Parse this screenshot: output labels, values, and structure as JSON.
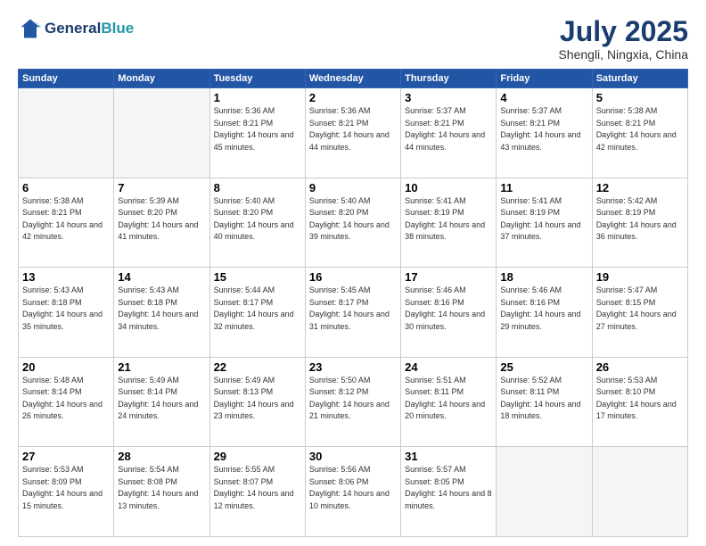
{
  "header": {
    "logo_line1": "General",
    "logo_line2": "Blue",
    "month": "July 2025",
    "location": "Shengli, Ningxia, China"
  },
  "weekdays": [
    "Sunday",
    "Monday",
    "Tuesday",
    "Wednesday",
    "Thursday",
    "Friday",
    "Saturday"
  ],
  "weeks": [
    [
      {
        "day": "",
        "sunrise": "",
        "sunset": "",
        "daylight": ""
      },
      {
        "day": "",
        "sunrise": "",
        "sunset": "",
        "daylight": ""
      },
      {
        "day": "1",
        "sunrise": "Sunrise: 5:36 AM",
        "sunset": "Sunset: 8:21 PM",
        "daylight": "Daylight: 14 hours and 45 minutes."
      },
      {
        "day": "2",
        "sunrise": "Sunrise: 5:36 AM",
        "sunset": "Sunset: 8:21 PM",
        "daylight": "Daylight: 14 hours and 44 minutes."
      },
      {
        "day": "3",
        "sunrise": "Sunrise: 5:37 AM",
        "sunset": "Sunset: 8:21 PM",
        "daylight": "Daylight: 14 hours and 44 minutes."
      },
      {
        "day": "4",
        "sunrise": "Sunrise: 5:37 AM",
        "sunset": "Sunset: 8:21 PM",
        "daylight": "Daylight: 14 hours and 43 minutes."
      },
      {
        "day": "5",
        "sunrise": "Sunrise: 5:38 AM",
        "sunset": "Sunset: 8:21 PM",
        "daylight": "Daylight: 14 hours and 42 minutes."
      }
    ],
    [
      {
        "day": "6",
        "sunrise": "Sunrise: 5:38 AM",
        "sunset": "Sunset: 8:21 PM",
        "daylight": "Daylight: 14 hours and 42 minutes."
      },
      {
        "day": "7",
        "sunrise": "Sunrise: 5:39 AM",
        "sunset": "Sunset: 8:20 PM",
        "daylight": "Daylight: 14 hours and 41 minutes."
      },
      {
        "day": "8",
        "sunrise": "Sunrise: 5:40 AM",
        "sunset": "Sunset: 8:20 PM",
        "daylight": "Daylight: 14 hours and 40 minutes."
      },
      {
        "day": "9",
        "sunrise": "Sunrise: 5:40 AM",
        "sunset": "Sunset: 8:20 PM",
        "daylight": "Daylight: 14 hours and 39 minutes."
      },
      {
        "day": "10",
        "sunrise": "Sunrise: 5:41 AM",
        "sunset": "Sunset: 8:19 PM",
        "daylight": "Daylight: 14 hours and 38 minutes."
      },
      {
        "day": "11",
        "sunrise": "Sunrise: 5:41 AM",
        "sunset": "Sunset: 8:19 PM",
        "daylight": "Daylight: 14 hours and 37 minutes."
      },
      {
        "day": "12",
        "sunrise": "Sunrise: 5:42 AM",
        "sunset": "Sunset: 8:19 PM",
        "daylight": "Daylight: 14 hours and 36 minutes."
      }
    ],
    [
      {
        "day": "13",
        "sunrise": "Sunrise: 5:43 AM",
        "sunset": "Sunset: 8:18 PM",
        "daylight": "Daylight: 14 hours and 35 minutes."
      },
      {
        "day": "14",
        "sunrise": "Sunrise: 5:43 AM",
        "sunset": "Sunset: 8:18 PM",
        "daylight": "Daylight: 14 hours and 34 minutes."
      },
      {
        "day": "15",
        "sunrise": "Sunrise: 5:44 AM",
        "sunset": "Sunset: 8:17 PM",
        "daylight": "Daylight: 14 hours and 32 minutes."
      },
      {
        "day": "16",
        "sunrise": "Sunrise: 5:45 AM",
        "sunset": "Sunset: 8:17 PM",
        "daylight": "Daylight: 14 hours and 31 minutes."
      },
      {
        "day": "17",
        "sunrise": "Sunrise: 5:46 AM",
        "sunset": "Sunset: 8:16 PM",
        "daylight": "Daylight: 14 hours and 30 minutes."
      },
      {
        "day": "18",
        "sunrise": "Sunrise: 5:46 AM",
        "sunset": "Sunset: 8:16 PM",
        "daylight": "Daylight: 14 hours and 29 minutes."
      },
      {
        "day": "19",
        "sunrise": "Sunrise: 5:47 AM",
        "sunset": "Sunset: 8:15 PM",
        "daylight": "Daylight: 14 hours and 27 minutes."
      }
    ],
    [
      {
        "day": "20",
        "sunrise": "Sunrise: 5:48 AM",
        "sunset": "Sunset: 8:14 PM",
        "daylight": "Daylight: 14 hours and 26 minutes."
      },
      {
        "day": "21",
        "sunrise": "Sunrise: 5:49 AM",
        "sunset": "Sunset: 8:14 PM",
        "daylight": "Daylight: 14 hours and 24 minutes."
      },
      {
        "day": "22",
        "sunrise": "Sunrise: 5:49 AM",
        "sunset": "Sunset: 8:13 PM",
        "daylight": "Daylight: 14 hours and 23 minutes."
      },
      {
        "day": "23",
        "sunrise": "Sunrise: 5:50 AM",
        "sunset": "Sunset: 8:12 PM",
        "daylight": "Daylight: 14 hours and 21 minutes."
      },
      {
        "day": "24",
        "sunrise": "Sunrise: 5:51 AM",
        "sunset": "Sunset: 8:11 PM",
        "daylight": "Daylight: 14 hours and 20 minutes."
      },
      {
        "day": "25",
        "sunrise": "Sunrise: 5:52 AM",
        "sunset": "Sunset: 8:11 PM",
        "daylight": "Daylight: 14 hours and 18 minutes."
      },
      {
        "day": "26",
        "sunrise": "Sunrise: 5:53 AM",
        "sunset": "Sunset: 8:10 PM",
        "daylight": "Daylight: 14 hours and 17 minutes."
      }
    ],
    [
      {
        "day": "27",
        "sunrise": "Sunrise: 5:53 AM",
        "sunset": "Sunset: 8:09 PM",
        "daylight": "Daylight: 14 hours and 15 minutes."
      },
      {
        "day": "28",
        "sunrise": "Sunrise: 5:54 AM",
        "sunset": "Sunset: 8:08 PM",
        "daylight": "Daylight: 14 hours and 13 minutes."
      },
      {
        "day": "29",
        "sunrise": "Sunrise: 5:55 AM",
        "sunset": "Sunset: 8:07 PM",
        "daylight": "Daylight: 14 hours and 12 minutes."
      },
      {
        "day": "30",
        "sunrise": "Sunrise: 5:56 AM",
        "sunset": "Sunset: 8:06 PM",
        "daylight": "Daylight: 14 hours and 10 minutes."
      },
      {
        "day": "31",
        "sunrise": "Sunrise: 5:57 AM",
        "sunset": "Sunset: 8:05 PM",
        "daylight": "Daylight: 14 hours and 8 minutes."
      },
      {
        "day": "",
        "sunrise": "",
        "sunset": "",
        "daylight": ""
      },
      {
        "day": "",
        "sunrise": "",
        "sunset": "",
        "daylight": ""
      }
    ]
  ]
}
